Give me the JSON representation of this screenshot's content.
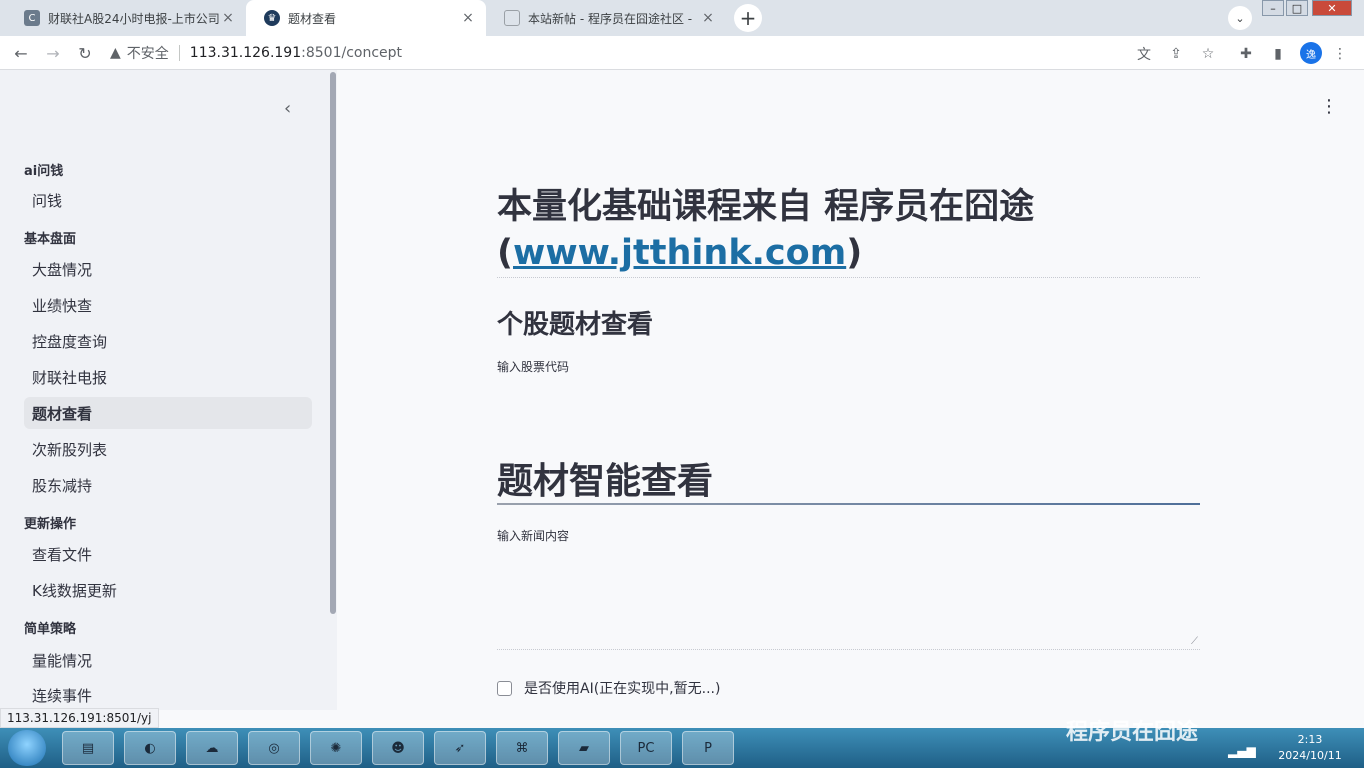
{
  "browser": {
    "tabs": [
      {
        "label": "财联社A股24小时电报-上市公司",
        "fav": "C",
        "active": false
      },
      {
        "label": "题材查看",
        "fav": "",
        "active": true
      },
      {
        "label": "本站新帖 - 程序员在囧途社区 -",
        "fav": "",
        "active": false
      }
    ],
    "newtab_glyph": "+",
    "insecure_label": "不安全",
    "url_host": "113.31.126.191",
    "url_path": ":8501/concept",
    "profile_label": "逸"
  },
  "sidebar": {
    "sections": [
      {
        "title": "ai问钱",
        "items": [
          "问钱"
        ]
      },
      {
        "title": "基本盘面",
        "items": [
          "大盘情况",
          "业绩快查",
          "控盘度查询",
          "财联社电报",
          "题材查看",
          "次新股列表",
          "股东减持"
        ]
      },
      {
        "title": "更新操作",
        "items": [
          "查看文件",
          "K线数据更新"
        ]
      },
      {
        "title": "简单策略",
        "items": [
          "量能情况",
          "连续事件"
        ]
      }
    ],
    "active_item": "题材查看"
  },
  "status_url": "113.31.126.191:8501/yj",
  "main": {
    "title_line1": "本量化基础课程来自 程序员在囧途",
    "title_paren_open": "(",
    "title_link": "www.jtthink.com",
    "title_paren_close": ")",
    "section1_title": "个股题材查看",
    "stock_code_label": "输入股票代码",
    "section2_title": "题材智能查看",
    "news_label": "输入新闻内容",
    "ai_checkbox_label": "是否使用AI(正在实现中,暂无...)"
  },
  "taskbar": {
    "watermark": "程序员在囧途",
    "clock_time": "2:13",
    "clock_date": "2024/10/11"
  },
  "colors": {
    "accent_link": "#1c6ea4",
    "sidebar_bg": "#f0f2f6",
    "main_bg": "#f8f9fb"
  }
}
